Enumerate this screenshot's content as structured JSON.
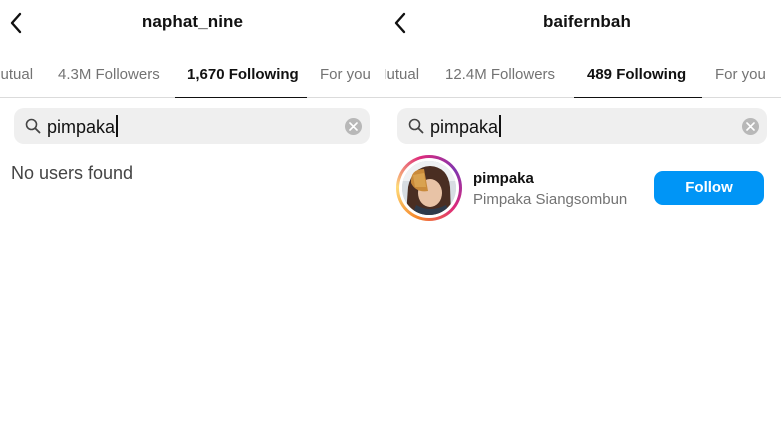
{
  "colors": {
    "accent": "#0095f6",
    "muted_text": "#737373",
    "search_bg": "#efefef"
  },
  "left_panel": {
    "header": {
      "back_icon": "chevron-left-icon",
      "title": "naphat_nine"
    },
    "tabs": [
      {
        "label": "Mutual",
        "active": false
      },
      {
        "label": "4.3M Followers",
        "active": false
      },
      {
        "label": "1,670 Following",
        "active": true
      },
      {
        "label": "For you",
        "active": false
      }
    ],
    "search": {
      "icon": "search-icon",
      "value": "pimpaka",
      "clear_icon": "clear-icon"
    },
    "empty_message": "No users found"
  },
  "right_panel": {
    "header": {
      "back_icon": "chevron-left-icon",
      "title": "baifernbah"
    },
    "tabs": [
      {
        "label": "Mutual",
        "active": false
      },
      {
        "label": "12.4M Followers",
        "active": false
      },
      {
        "label": "489 Following",
        "active": true
      },
      {
        "label": "For you",
        "active": false
      }
    ],
    "search": {
      "icon": "search-icon",
      "value": "pimpaka",
      "clear_icon": "clear-icon"
    },
    "results": [
      {
        "username": "pimpaka",
        "full_name": "Pimpaka Siangsombun",
        "button_label": "Follow",
        "avatar_icon": "profile-photo"
      }
    ]
  }
}
